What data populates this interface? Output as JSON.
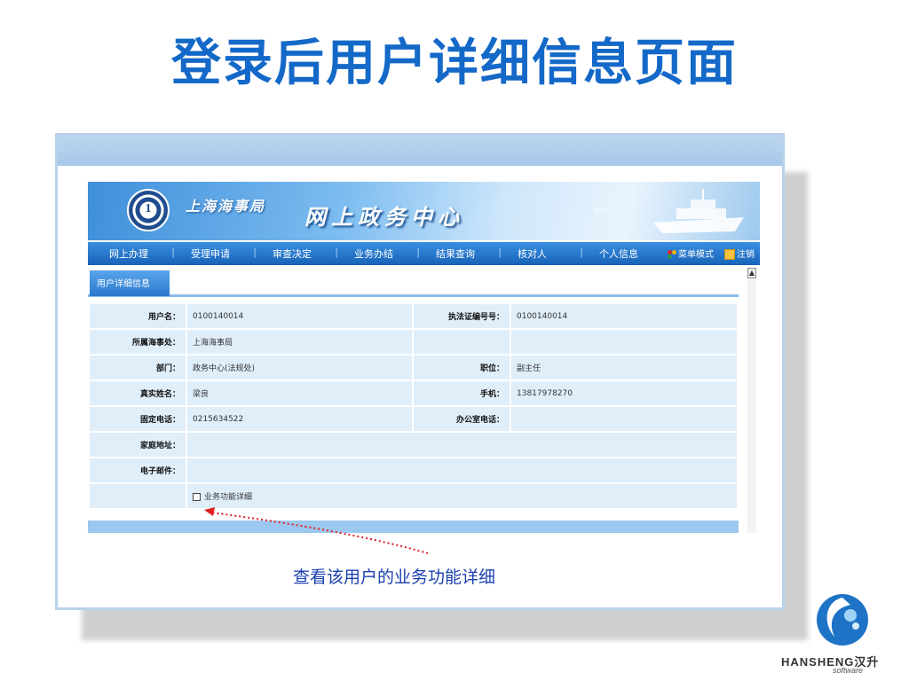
{
  "slide": {
    "title": "登录后用户详细信息页面",
    "caption": "查看该用户的业务功能详细"
  },
  "app": {
    "org_name": "上海海事局",
    "title": "网上政务中心",
    "emblem_text": "1",
    "nav": {
      "items": [
        "网上办理",
        "受理申请",
        "审查决定",
        "业务办结",
        "结果查询",
        "核对人",
        "个人信息"
      ],
      "menu_mode_label": "菜单模式",
      "logout_label": "注销"
    },
    "tab_label": "用户详细信息",
    "scroll_up": "▲"
  },
  "form": {
    "rows": [
      {
        "label1": "用户名：",
        "value1": "0100140014",
        "label2": "执法证编号号：",
        "value2": "0100140014"
      },
      {
        "label1": "所属海事处：",
        "value1": "上海海事局",
        "label2": "",
        "value2": ""
      },
      {
        "label1": "部门：",
        "value1": "政务中心(法规处)",
        "label2": "职位：",
        "value2": "副主任"
      },
      {
        "label1": "真实姓名：",
        "value1": "梁良",
        "label2": "手机：",
        "value2": "13817978270"
      },
      {
        "label1": "固定电话：",
        "value1": "0215634522",
        "label2": "办公室电话：",
        "value2": ""
      },
      {
        "label1": "家庭地址：",
        "value1": ""
      },
      {
        "label1": "电子邮件：",
        "value1": ""
      }
    ],
    "checkbox_label": "业务功能详细"
  },
  "brand": {
    "name": "HANSHENG汉升",
    "sub": "software"
  },
  "colors": {
    "title": "#1469c8",
    "nav": "#1762b8",
    "cell": "#e0eefa",
    "arrow": "#e02020"
  }
}
